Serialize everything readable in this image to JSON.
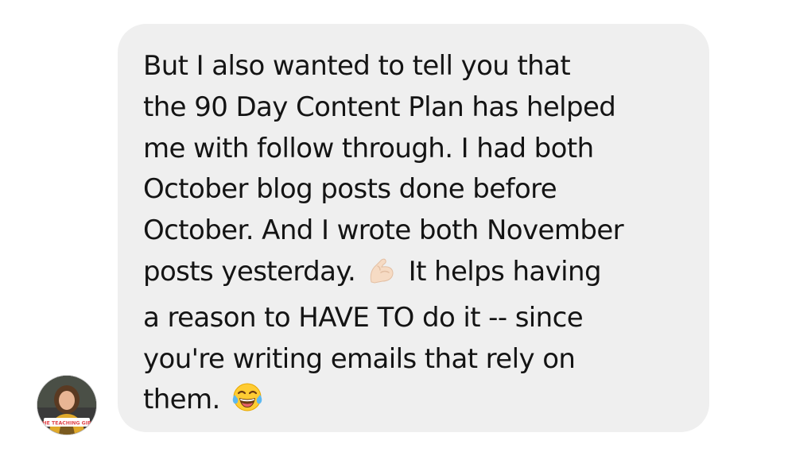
{
  "conversation": {
    "message": {
      "lines": [
        {
          "text": "But I also wanted to tell you that"
        },
        {
          "text": "the 90 Day Content Plan has helped"
        },
        {
          "text": "me with follow through. I had both"
        },
        {
          "text": "October blog posts done before"
        },
        {
          "text": "October. And I wrote both November"
        },
        {
          "before": "posts yesterday.",
          "emoji": "flexed-biceps-icon",
          "after": "It helps having"
        },
        {
          "text": "a reason to HAVE TO do it -- since"
        },
        {
          "text": "you're writing emails that rely on"
        },
        {
          "before": "them.",
          "emoji": "tears-of-joy-face-icon"
        }
      ]
    },
    "sender": {
      "avatar_icon": "profile-photo-icon",
      "avatar_banner": "THE TEACHING GIRL"
    }
  },
  "colors": {
    "bubble": "#efefef",
    "text": "#141414",
    "background": "#ffffff"
  }
}
